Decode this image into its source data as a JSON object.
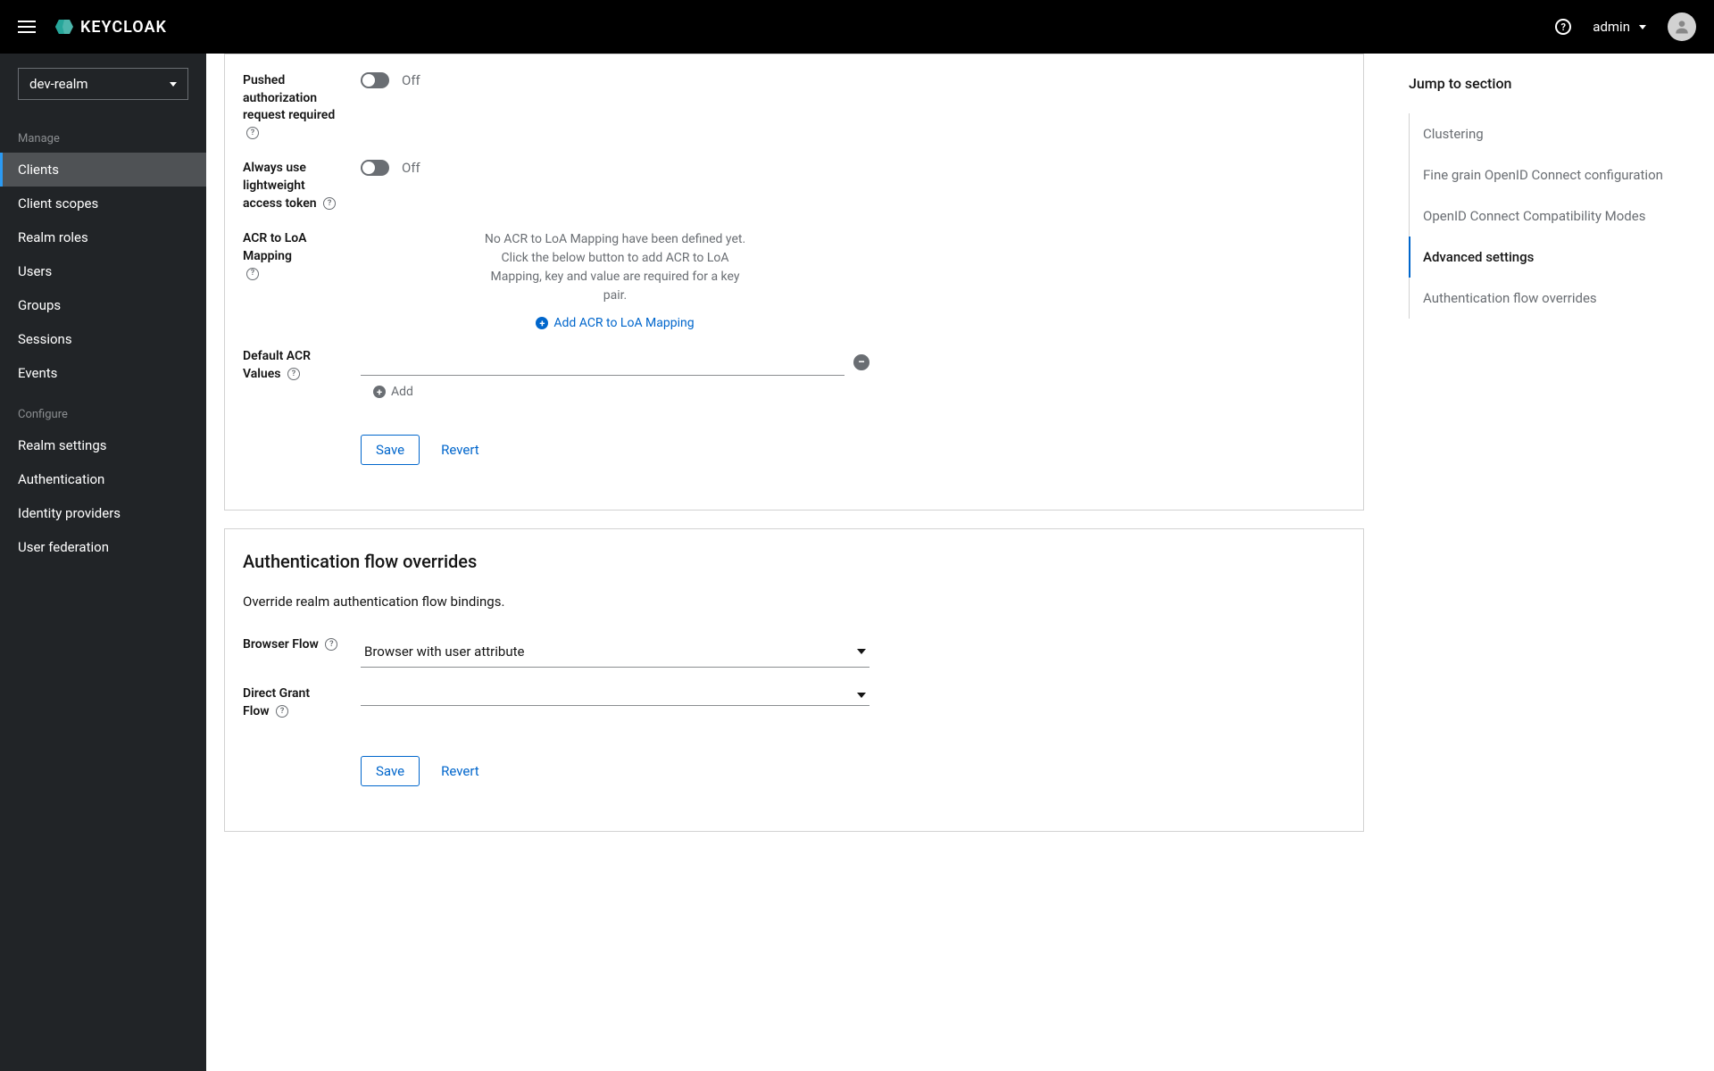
{
  "topbar": {
    "logo_text": "KEYCLOAK",
    "user": "admin"
  },
  "sidebar": {
    "realm": "dev-realm",
    "manage_label": "Manage",
    "configure_label": "Configure",
    "items_manage": [
      {
        "label": "Clients",
        "active": true
      },
      {
        "label": "Client scopes"
      },
      {
        "label": "Realm roles"
      },
      {
        "label": "Users"
      },
      {
        "label": "Groups"
      },
      {
        "label": "Sessions"
      },
      {
        "label": "Events"
      }
    ],
    "items_configure": [
      {
        "label": "Realm settings"
      },
      {
        "label": "Authentication"
      },
      {
        "label": "Identity providers"
      },
      {
        "label": "User federation"
      }
    ]
  },
  "advanced": {
    "pushed_auth_label": "Pushed authorization request required",
    "lightweight_label": "Always use lightweight access token",
    "off": "Off",
    "acr_mapping_label": "ACR to LoA Mapping",
    "acr_empty": "No ACR to LoA Mapping have been defined yet. Click the below button to add ACR to LoA Mapping, key and value are required for a key pair.",
    "acr_add": "Add ACR to LoA Mapping",
    "default_acr_label": "Default ACR Values",
    "add": "Add",
    "save": "Save",
    "revert": "Revert"
  },
  "auth_flow": {
    "title": "Authentication flow overrides",
    "desc": "Override realm authentication flow bindings.",
    "browser_label": "Browser Flow",
    "browser_value": "Browser with user attribute",
    "direct_label": "Direct Grant Flow",
    "direct_value": "",
    "save": "Save",
    "revert": "Revert"
  },
  "jump": {
    "title": "Jump to section",
    "items": [
      {
        "label": "Clustering"
      },
      {
        "label": "Fine grain OpenID Connect configuration"
      },
      {
        "label": "OpenID Connect Compatibility Modes"
      },
      {
        "label": "Advanced settings",
        "active": true
      },
      {
        "label": "Authentication flow overrides"
      }
    ]
  }
}
